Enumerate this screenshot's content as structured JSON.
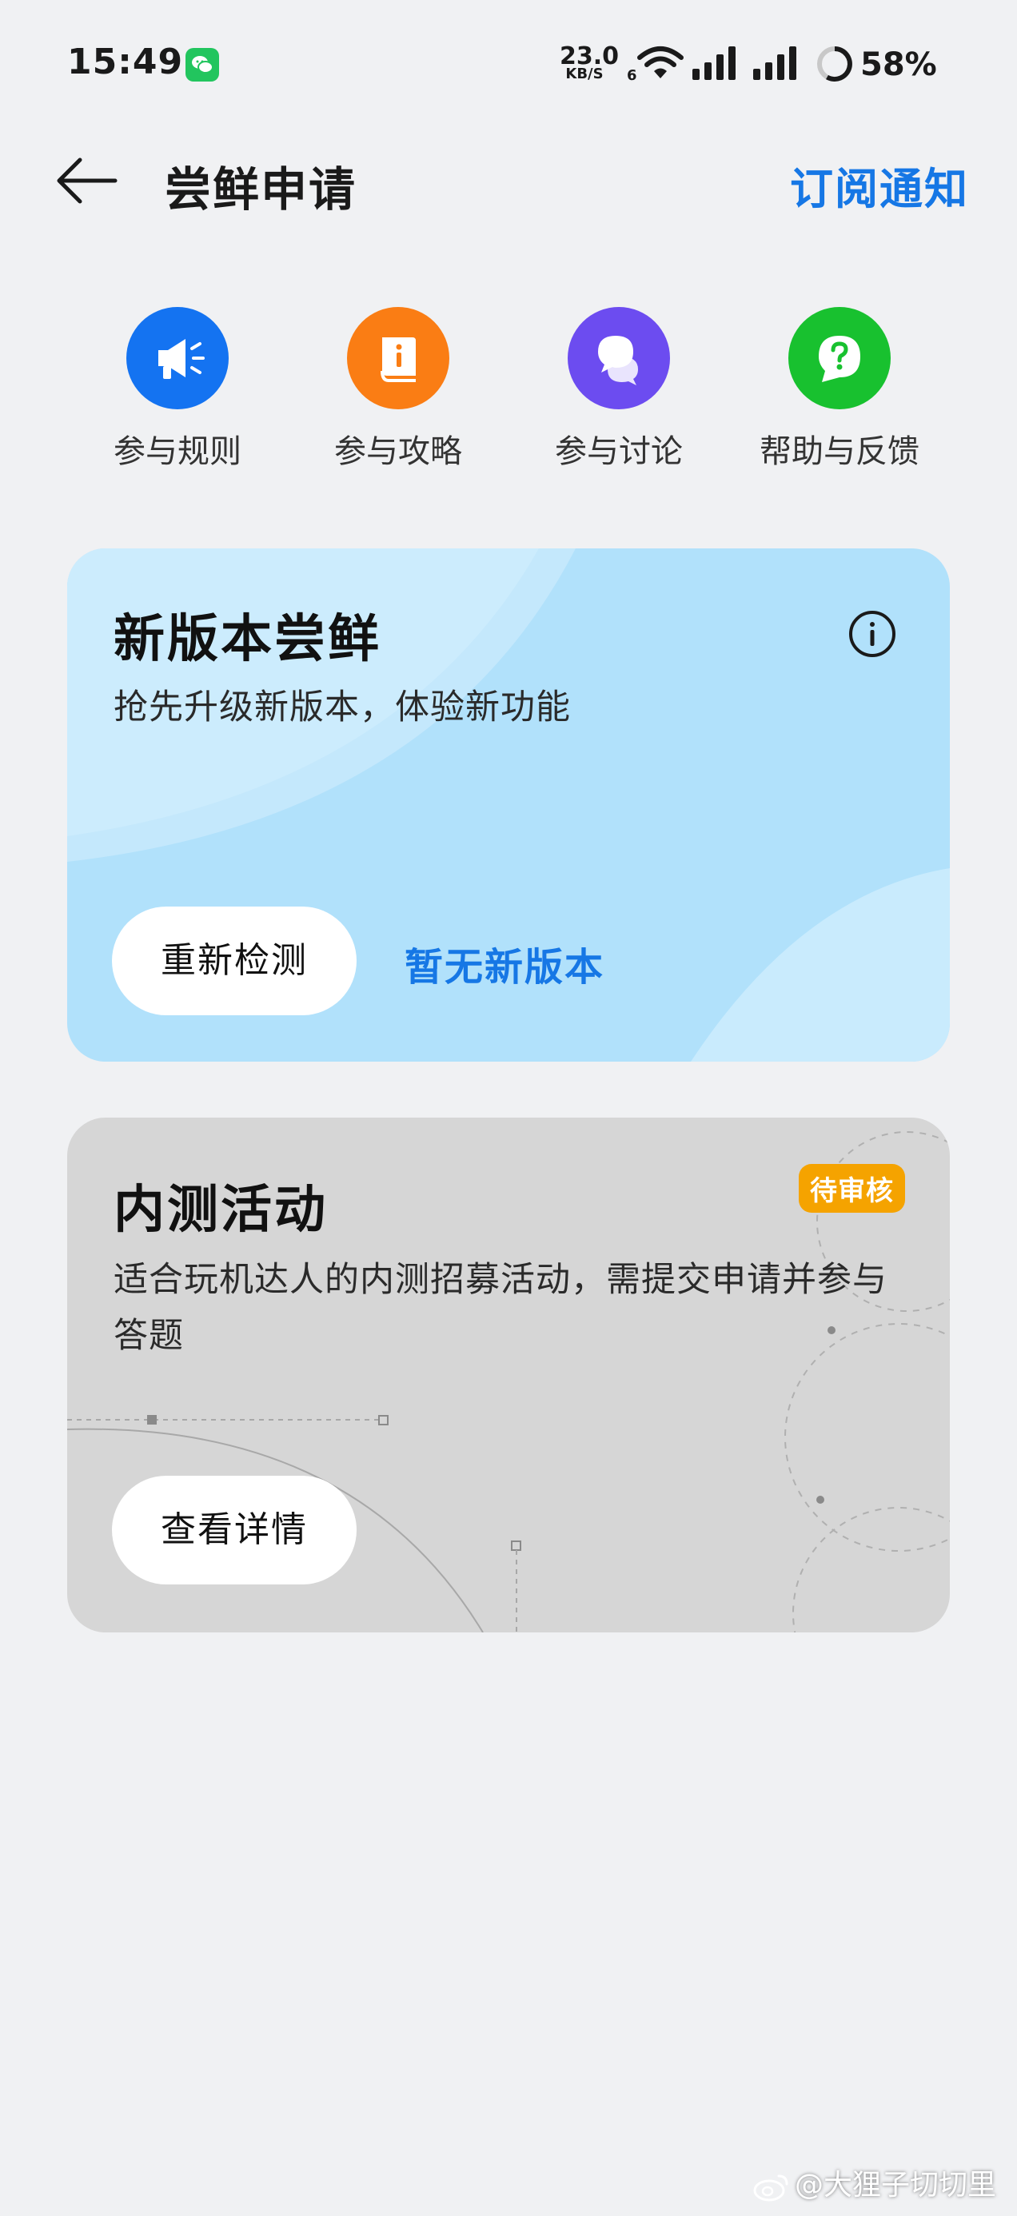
{
  "status_bar": {
    "time": "15:49",
    "net_speed_value": "23.0",
    "net_speed_unit": "KB/S",
    "wifi_badge": "6",
    "battery": "58%"
  },
  "header": {
    "title": "尝鲜申请",
    "subscribe_label": "订阅通知"
  },
  "shortcuts": [
    {
      "label": "参与规则",
      "icon": "megaphone-icon",
      "color": "#1473f1"
    },
    {
      "label": "参与攻略",
      "icon": "guide-book-icon",
      "color": "#fa7d14"
    },
    {
      "label": "参与讨论",
      "icon": "chat-bubbles-icon",
      "color": "#6c4cf0"
    },
    {
      "label": "帮助与反馈",
      "icon": "help-question-icon",
      "color": "#18c12f"
    }
  ],
  "new_version_card": {
    "title": "新版本尝鲜",
    "description": "抢先升级新版本，体验新功能",
    "button_label": "重新检测",
    "status_text": "暂无新版本",
    "background": "#b1e1fb"
  },
  "beta_card": {
    "title": "内测活动",
    "badge": "待审核",
    "description": "适合玩机达人的内测招募活动，需提交申请并参与答题",
    "button_label": "查看详情",
    "background": "#d6d6d6"
  },
  "watermark": "@大狸子切切里",
  "colors": {
    "accent_blue": "#1677e5",
    "page_background": "#f0f1f3",
    "badge_orange": "#f5a300"
  }
}
